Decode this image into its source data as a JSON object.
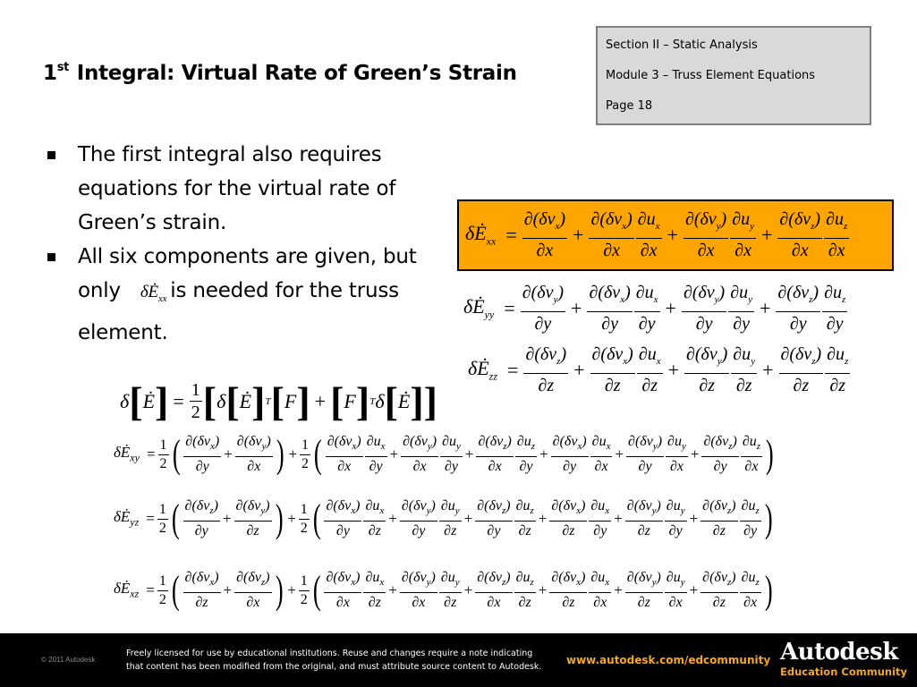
{
  "slide": {
    "title_prefix": "1",
    "title_sup": "st",
    "title_rest": " Integral: Virtual Rate of Green’s Strain"
  },
  "info_box": {
    "section": "Section II – Static Analysis",
    "module": "Module 3 – Truss Element Equations",
    "page": "Page 18"
  },
  "bullets": {
    "b1": "The first integral also requires equations for the virtual rate of Green’s strain.",
    "b2_before": "All six components are given, but only",
    "b2_sym": "δĖ",
    "b2_sym_sub": "xx",
    "b2_after": "is needed for the truss element."
  },
  "equations": {
    "exx": {
      "lhs": "δĖ",
      "lhs_sub": "xx",
      "terms": [
        {
          "num": "∂(δv",
          "num_sub": "x",
          "num_end": ")",
          "den": "∂x"
        },
        {
          "num": "∂(δv",
          "num_sub": "x",
          "num_end": ")",
          "den": "∂x",
          "num2": "∂u",
          "num2_sub": "x",
          "den2": "∂x"
        },
        {
          "num": "∂(δv",
          "num_sub": "y",
          "num_end": ")",
          "den": "∂x",
          "num2": "∂u",
          "num2_sub": "y",
          "den2": "∂x"
        },
        {
          "num": "∂(δv",
          "num_sub": "z",
          "num_end": ")",
          "den": "∂x",
          "num2": "∂u",
          "num2_sub": "z",
          "den2": "∂x"
        }
      ]
    },
    "eyy": {
      "lhs": "δĖ",
      "lhs_sub": "yy",
      "terms": [
        {
          "num": "∂(δv",
          "num_sub": "y",
          "num_end": ")",
          "den": "∂y"
        },
        {
          "num": "∂(δv",
          "num_sub": "x",
          "num_end": ")",
          "den": "∂y",
          "num2": "∂u",
          "num2_sub": "x",
          "den2": "∂y"
        },
        {
          "num": "∂(δv",
          "num_sub": "y",
          "num_end": ")",
          "den": "∂y",
          "num2": "∂u",
          "num2_sub": "y",
          "den2": "∂y"
        },
        {
          "num": "∂(δv",
          "num_sub": "z",
          "num_end": ")",
          "den": "∂y",
          "num2": "∂u",
          "num2_sub": "z",
          "den2": "∂y"
        }
      ]
    },
    "ezz": {
      "lhs": "δĖ",
      "lhs_sub": "zz",
      "terms": [
        {
          "num": "∂(δv",
          "num_sub": "z",
          "num_end": ")",
          "den": "∂z"
        },
        {
          "num": "∂(δv",
          "num_sub": "x",
          "num_end": ")",
          "den": "∂z",
          "num2": "∂u",
          "num2_sub": "x",
          "den2": "∂z"
        },
        {
          "num": "∂(δv",
          "num_sub": "y",
          "num_end": ")",
          "den": "∂z",
          "num2": "∂u",
          "num2_sub": "y",
          "den2": "∂z"
        },
        {
          "num": "∂(δv",
          "num_sub": "z",
          "num_end": ")",
          "den": "∂z",
          "num2": "∂u",
          "num2_sub": "z",
          "den2": "∂z"
        }
      ]
    },
    "matrix": {
      "delta": "δ",
      "E": "Ė",
      "eq": "=",
      "half_num": "1",
      "half_den": "2",
      "F": "F",
      "T": "T",
      "plus": "+"
    },
    "exy": {
      "lhs": "δĖ",
      "lhs_sub": "xy",
      "first": [
        {
          "num_sub": "x",
          "den": "∂y"
        },
        {
          "num_sub": "y",
          "den": "∂x"
        }
      ],
      "second": [
        {
          "num_sub": "x",
          "den": "∂x",
          "u_sub": "x",
          "den2": "∂y"
        },
        {
          "num_sub": "y",
          "den": "∂x",
          "u_sub": "y",
          "den2": "∂y"
        },
        {
          "num_sub": "z",
          "den": "∂x",
          "u_sub": "z",
          "den2": "∂y"
        },
        {
          "num_sub": "x",
          "den": "∂y",
          "u_sub": "x",
          "den2": "∂x"
        },
        {
          "num_sub": "y",
          "den": "∂y",
          "u_sub": "y",
          "den2": "∂x"
        },
        {
          "num_sub": "z",
          "den": "∂y",
          "u_sub": "z",
          "den2": "∂x"
        }
      ]
    },
    "eyz": {
      "lhs": "δĖ",
      "lhs_sub": "yz",
      "first": [
        {
          "num_sub": "z",
          "den": "∂y"
        },
        {
          "num_sub": "y",
          "den": "∂z"
        }
      ],
      "second": [
        {
          "num_sub": "x",
          "den": "∂y",
          "u_sub": "x",
          "den2": "∂z"
        },
        {
          "num_sub": "y",
          "den": "∂y",
          "u_sub": "y",
          "den2": "∂z"
        },
        {
          "num_sub": "z",
          "den": "∂y",
          "u_sub": "z",
          "den2": "∂z"
        },
        {
          "num_sub": "x",
          "den": "∂z",
          "u_sub": "x",
          "den2": "∂y"
        },
        {
          "num_sub": "y",
          "den": "∂z",
          "u_sub": "y",
          "den2": "∂y"
        },
        {
          "num_sub": "z",
          "den": "∂z",
          "u_sub": "z",
          "den2": "∂y"
        }
      ]
    },
    "exz": {
      "lhs": "δĖ",
      "lhs_sub": "xz",
      "first": [
        {
          "num_sub": "x",
          "den": "∂z"
        },
        {
          "num_sub": "z",
          "den": "∂x"
        }
      ],
      "second": [
        {
          "num_sub": "x",
          "den": "∂x",
          "u_sub": "x",
          "den2": "∂z"
        },
        {
          "num_sub": "y",
          "den": "∂x",
          "u_sub": "y",
          "den2": "∂z"
        },
        {
          "num_sub": "z",
          "den": "∂x",
          "u_sub": "z",
          "den2": "∂z"
        },
        {
          "num_sub": "x",
          "den": "∂z",
          "u_sub": "x",
          "den2": "∂x"
        },
        {
          "num_sub": "y",
          "den": "∂z",
          "u_sub": "y",
          "den2": "∂x"
        },
        {
          "num_sub": "z",
          "den": "∂z",
          "u_sub": "z",
          "den2": "∂x"
        }
      ]
    }
  },
  "footer": {
    "copyright": "© 2011 Autodesk",
    "license_line1": "Freely licensed for use by educational institutions. Reuse and changes require a note indicating",
    "license_line2": "that content has been modified from the original, and must attribute source content to Autodesk.",
    "url": "www.autodesk.com/edcommunity",
    "brand": "Autodesk",
    "brand_sub": "Education Community"
  },
  "colors": {
    "highlight": "#ffa500",
    "info_box_bg": "#d9d9d9",
    "footer_bg": "#000000",
    "footer_accent": "#f5a623"
  }
}
